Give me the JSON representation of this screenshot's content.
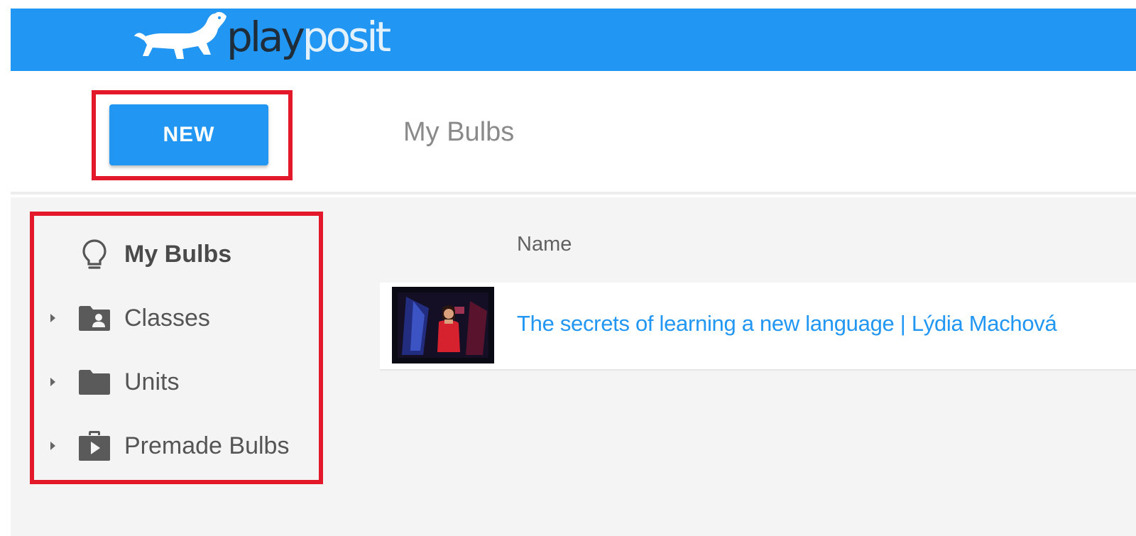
{
  "app": {
    "logo_text_play": "play",
    "logo_text_posit": "posit"
  },
  "toolbar": {
    "new_label": "NEW",
    "page_title": "My Bulbs"
  },
  "sidebar": {
    "items": [
      {
        "label": "My Bulbs",
        "icon": "lightbulb-icon",
        "expandable": false,
        "active": true
      },
      {
        "label": "Classes",
        "icon": "class-folder-icon",
        "expandable": true,
        "active": false
      },
      {
        "label": "Units",
        "icon": "folder-icon",
        "expandable": true,
        "active": false
      },
      {
        "label": "Premade Bulbs",
        "icon": "premade-case-icon",
        "expandable": true,
        "active": false
      }
    ]
  },
  "table": {
    "columns": [
      "Name"
    ],
    "rows": [
      {
        "title": "The secrets of learning a new language | Lýdia Machová",
        "thumbnail": "video-thumbnail"
      }
    ]
  },
  "colors": {
    "brand_blue": "#2196f3",
    "highlight_red": "#e3182a",
    "sidebar_bg": "#f4f4f4"
  }
}
